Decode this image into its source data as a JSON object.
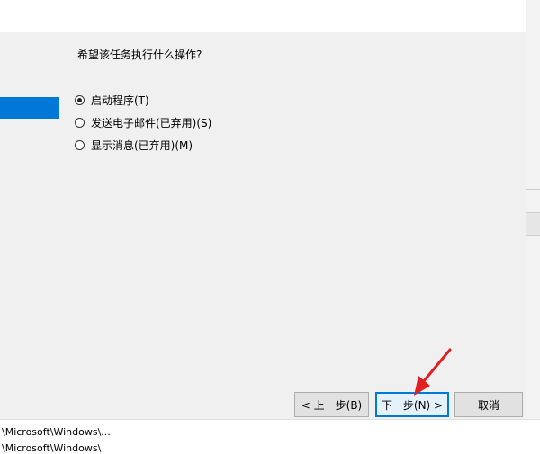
{
  "dialog": {
    "question": "希望该任务执行什么操作?",
    "options": [
      {
        "label": "启动程序(T)",
        "checked": true
      },
      {
        "label": "发送电子邮件(已弃用)(S)",
        "checked": false
      },
      {
        "label": "显示消息(已弃用)(M)",
        "checked": false
      }
    ],
    "buttons": {
      "back": "< 上一步(B)",
      "next": "下一步(N) >",
      "cancel": "取消"
    }
  },
  "background_paths": [
    "\\Microsoft\\Windows\\...",
    "\\Microsoft\\Windows\\"
  ],
  "colors": {
    "accent": "#0078d7",
    "annotation_arrow": "#e02020"
  }
}
